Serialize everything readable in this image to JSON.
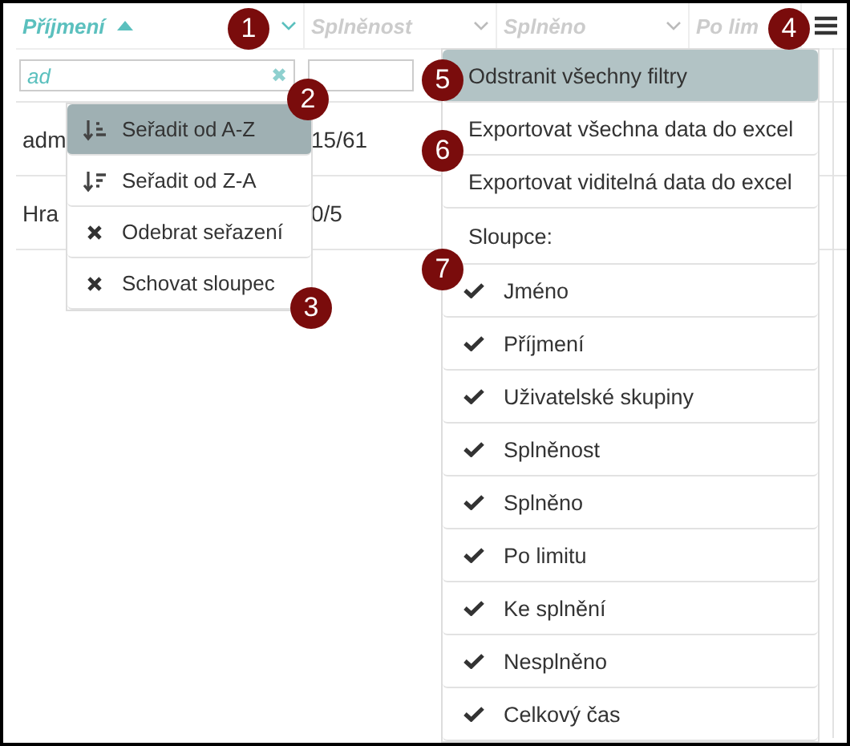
{
  "header": [
    {
      "label": "Příjmení",
      "sorted": true,
      "active": true
    },
    {
      "label": "Splněnost",
      "sorted": false,
      "active": false
    },
    {
      "label": "Splněno",
      "sorted": false,
      "active": false
    },
    {
      "label": "Po lim",
      "sorted": false,
      "active": false
    }
  ],
  "filter": {
    "value": "ad",
    "clear": "✖"
  },
  "rows": [
    [
      "adm",
      "15/61"
    ],
    [
      "Hra",
      "0/5"
    ]
  ],
  "column_menu": [
    {
      "kind": "sort-asc",
      "label": "Seřadit od A-Z",
      "selected": true
    },
    {
      "kind": "sort-desc",
      "label": "Seřadit od Z-A",
      "selected": false
    },
    {
      "kind": "remove",
      "label": "Odebrat seřazení",
      "selected": false
    },
    {
      "kind": "remove",
      "label": "Schovat sloupec",
      "selected": false
    }
  ],
  "grid_menu": {
    "actions": [
      {
        "label": "Odstranit všechny filtry",
        "selected": true
      },
      {
        "label": "Exportovat všechna data do excel",
        "selected": false
      },
      {
        "label": "Exportovat viditelná data do excel",
        "selected": false
      }
    ],
    "columns_label": "Sloupce:",
    "columns": [
      {
        "label": "Jméno",
        "checked": true
      },
      {
        "label": "Příjmení",
        "checked": true
      },
      {
        "label": "Uživatelské skupiny",
        "checked": true
      },
      {
        "label": "Splněnost",
        "checked": true
      },
      {
        "label": "Splněno",
        "checked": true
      },
      {
        "label": "Po limitu",
        "checked": true
      },
      {
        "label": "Ke splnění",
        "checked": true
      },
      {
        "label": "Nesplněno",
        "checked": true
      },
      {
        "label": "Celkový čas",
        "checked": true
      }
    ]
  },
  "callouts": [
    "1",
    "2",
    "3",
    "4",
    "5",
    "6",
    "7"
  ]
}
